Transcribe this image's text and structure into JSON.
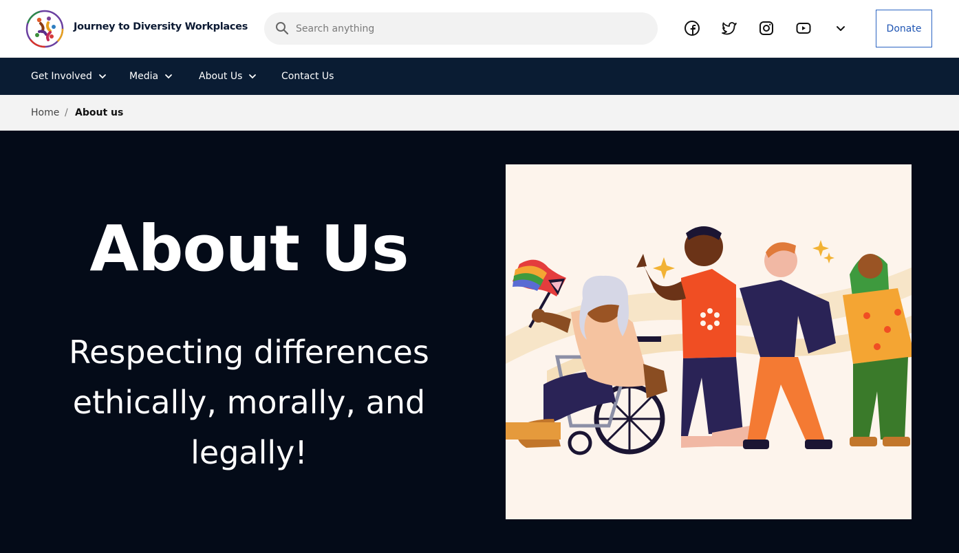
{
  "header": {
    "brand": "Journey to Diversity Workplaces",
    "search_placeholder": "Search anything",
    "social": [
      "facebook-icon",
      "twitter-icon",
      "instagram-icon",
      "youtube-icon",
      "chevron-down-icon"
    ],
    "donate_label": "Donate"
  },
  "nav": {
    "items": [
      {
        "label": "Get Involved",
        "has_dropdown": true
      },
      {
        "label": "Media",
        "has_dropdown": true
      },
      {
        "label": "About Us",
        "has_dropdown": true
      },
      {
        "label": "Contact Us",
        "has_dropdown": false
      }
    ]
  },
  "breadcrumb": {
    "home": "Home",
    "separator": "/",
    "current": "About us"
  },
  "hero": {
    "title": "About Us",
    "subtitle_line1": "Respecting differences",
    "subtitle_line2": "ethically, morally, and",
    "subtitle_line3": "legally!"
  },
  "colors": {
    "header_bg": "#ffffff",
    "nav_bg": "#0a1c33",
    "hero_bg": "#040b18",
    "donate_border": "#2a63c2",
    "illustration_bg": "#fdf4ec"
  }
}
